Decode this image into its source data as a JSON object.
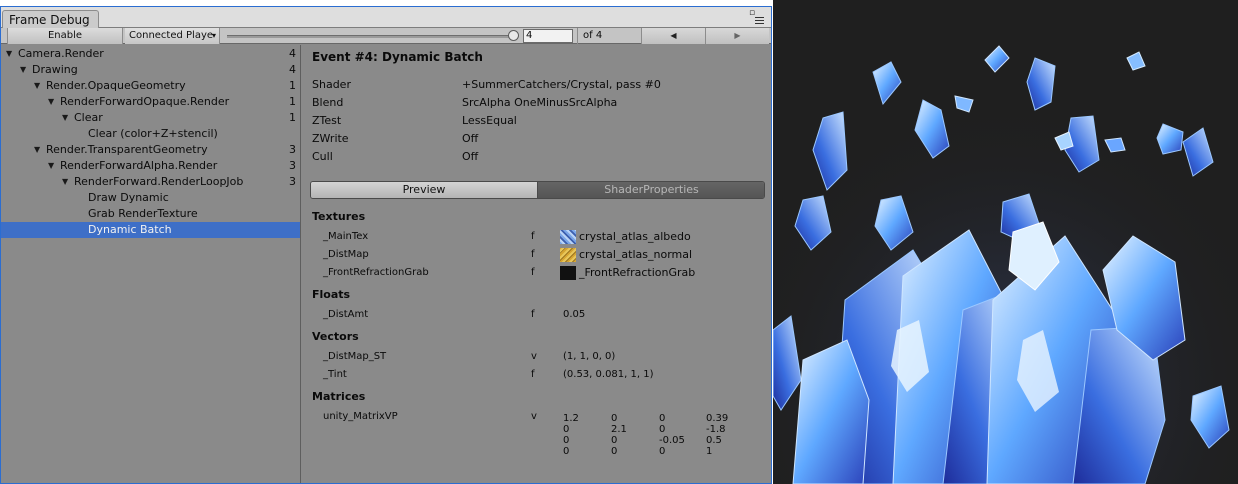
{
  "window": {
    "tab_title": "Frame Debug",
    "toolbar": {
      "enable_label": "Enable",
      "player_dropdown": "Connected Playe",
      "frame_value": "4",
      "of_label": "of 4",
      "progress_fraction": 1.0
    }
  },
  "tree": [
    {
      "label": "Camera.Render",
      "count": "4",
      "depth": 0,
      "expanded": true
    },
    {
      "label": "Drawing",
      "count": "4",
      "depth": 1,
      "expanded": true
    },
    {
      "label": "Render.OpaqueGeometry",
      "count": "1",
      "depth": 2,
      "expanded": true
    },
    {
      "label": "RenderForwardOpaque.Render",
      "count": "1",
      "depth": 3,
      "expanded": true
    },
    {
      "label": "Clear",
      "count": "1",
      "depth": 4,
      "expanded": true
    },
    {
      "label": "Clear (color+Z+stencil)",
      "count": "",
      "depth": 5,
      "expanded": false
    },
    {
      "label": "Render.TransparentGeometry",
      "count": "3",
      "depth": 2,
      "expanded": true
    },
    {
      "label": "RenderForwardAlpha.Render",
      "count": "3",
      "depth": 3,
      "expanded": true
    },
    {
      "label": "RenderForward.RenderLoopJob",
      "count": "3",
      "depth": 4,
      "expanded": true
    },
    {
      "label": "Draw Dynamic",
      "count": "",
      "depth": 5,
      "expanded": false
    },
    {
      "label": "Grab RenderTexture",
      "count": "",
      "depth": 5,
      "expanded": false
    },
    {
      "label": "Dynamic Batch",
      "count": "",
      "depth": 5,
      "expanded": false,
      "selected": true
    }
  ],
  "event": {
    "title": "Event #4: Dynamic Batch",
    "props": [
      {
        "key": "Shader",
        "value": "+SummerCatchers/Crystal, pass #0"
      },
      {
        "key": "Blend",
        "value": "SrcAlpha OneMinusSrcAlpha"
      },
      {
        "key": "ZTest",
        "value": "LessEqual"
      },
      {
        "key": "ZWrite",
        "value": "Off"
      },
      {
        "key": "Cull",
        "value": "Off"
      }
    ],
    "tabs": {
      "preview": "Preview",
      "shader_properties": "ShaderProperties",
      "active": "ShaderProperties"
    }
  },
  "shader_properties": {
    "textures_heading": "Textures",
    "textures": [
      {
        "name": "_MainTex",
        "type": "f",
        "value": "crystal_atlas_albedo",
        "thumb": "albedo"
      },
      {
        "name": "_DistMap",
        "type": "f",
        "value": "crystal_atlas_normal",
        "thumb": "normal"
      },
      {
        "name": "_FrontRefractionGrab",
        "type": "f",
        "value": "_FrontRefractionGrab",
        "thumb": "black"
      }
    ],
    "floats_heading": "Floats",
    "floats": [
      {
        "name": "_DistAmt",
        "type": "f",
        "value": "0.05"
      }
    ],
    "vectors_heading": "Vectors",
    "vectors": [
      {
        "name": "_DistMap_ST",
        "type": "v",
        "value": "(1, 1, 0, 0)"
      },
      {
        "name": "_Tint",
        "type": "f",
        "value": "(0.53, 0.081, 1, 1)"
      }
    ],
    "matrices_heading": "Matrices",
    "matrices": [
      {
        "name": "unity_MatrixVP",
        "type": "v",
        "rows": [
          [
            "1.2",
            "0",
            "0",
            "0.39"
          ],
          [
            "0",
            "2.1",
            "0",
            "-1.8"
          ],
          [
            "0",
            "0",
            "-0.05",
            "0.5"
          ],
          [
            "0",
            "0",
            "0",
            "1"
          ]
        ]
      }
    ]
  },
  "colors": {
    "panel_bg": "#8a8a8a",
    "selection": "#3e6fc7",
    "scene_bg": "#1f1f1f",
    "crystal_light": "#d6ecff",
    "crystal_mid": "#5fa8ff",
    "crystal_dark": "#2a3fb8"
  }
}
